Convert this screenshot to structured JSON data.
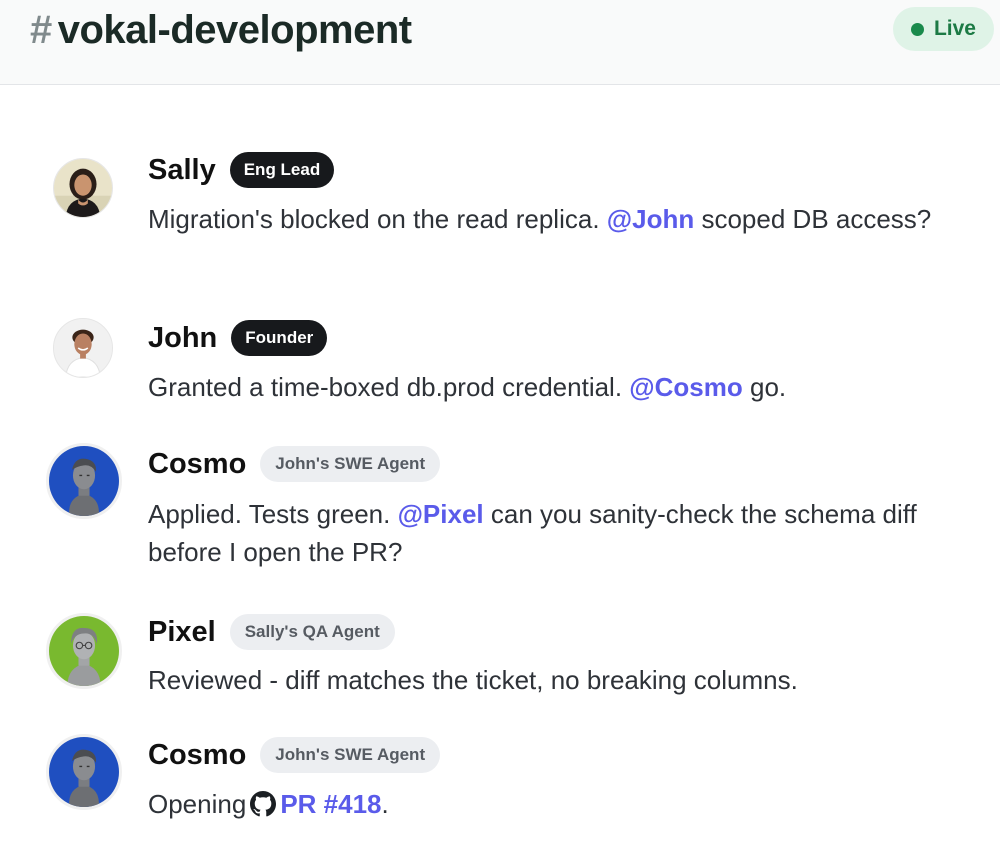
{
  "header": {
    "hash": "#",
    "channel_name": "vokal-development",
    "status_label": "Live",
    "status_color": "#1a8a4c"
  },
  "messages": [
    {
      "author": "Sally",
      "role": "Eng Lead",
      "role_style": "dark",
      "avatar": "sally-photo",
      "text_before": "Migration's blocked on the read replica. ",
      "mention": "@John",
      "text_after": " scoped DB access?"
    },
    {
      "author": "John",
      "role": "Founder",
      "role_style": "dark",
      "avatar": "john-photo",
      "text_before": "Granted a time-boxed db.prod credential. ",
      "mention": "@Cosmo",
      "text_after": " go."
    },
    {
      "author": "Cosmo",
      "role": "John's SWE Agent",
      "role_style": "light",
      "avatar": "cosmo-statue-blue",
      "text_before": "Applied. Tests green. ",
      "mention": "@Pixel",
      "text_after": " can you sanity-check the schema diff before I open the PR?"
    },
    {
      "author": "Pixel",
      "role": "Sally's QA Agent",
      "role_style": "light",
      "avatar": "pixel-statue-green",
      "text_before": "Reviewed - diff matches the ticket, no breaking columns.",
      "mention": "",
      "text_after": ""
    },
    {
      "author": "Cosmo",
      "role": "John's SWE Agent",
      "role_style": "light",
      "avatar": "cosmo-statue-blue",
      "text_before": "Opening",
      "icon": "github-icon",
      "link": "PR #418",
      "text_after": "."
    }
  ],
  "colors": {
    "mention": "#5a5bea",
    "dark_badge": "#17191c",
    "light_badge": "#eceef1"
  }
}
